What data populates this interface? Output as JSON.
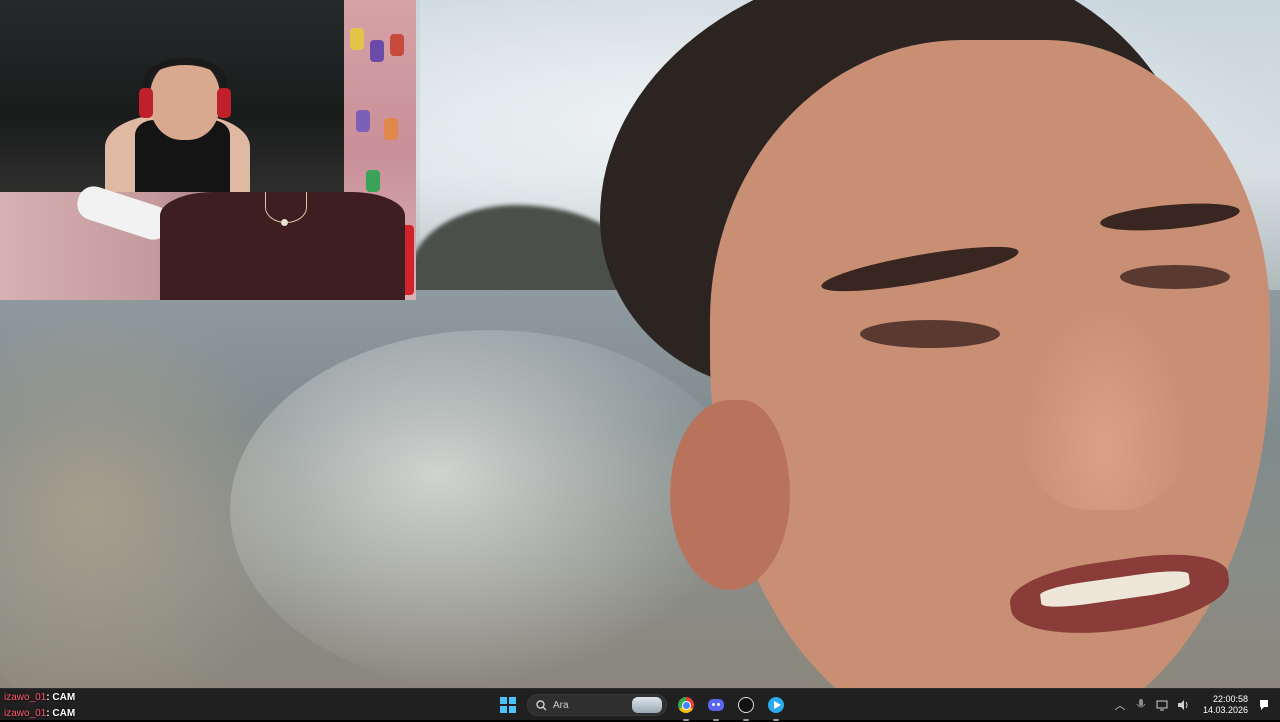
{
  "chat": {
    "lines": [
      {
        "user": "izawo_01",
        "message": ": CAM"
      },
      {
        "user": "izawo_01",
        "message": ": CAM"
      }
    ]
  },
  "taskbar": {
    "search_placeholder": "Ara",
    "apps": [
      "start-icon",
      "search-icon",
      "chrome-icon",
      "discord-icon",
      "obs-icon",
      "telegram-icon"
    ],
    "clock_time": "22:00:58",
    "clock_date": "14.03.2026",
    "start_color": "#4cc2ff"
  },
  "tray": {
    "icons": [
      "chevron-up-icon",
      "microphone-icon",
      "network-icon",
      "volume-icon",
      "notification-icon"
    ]
  }
}
